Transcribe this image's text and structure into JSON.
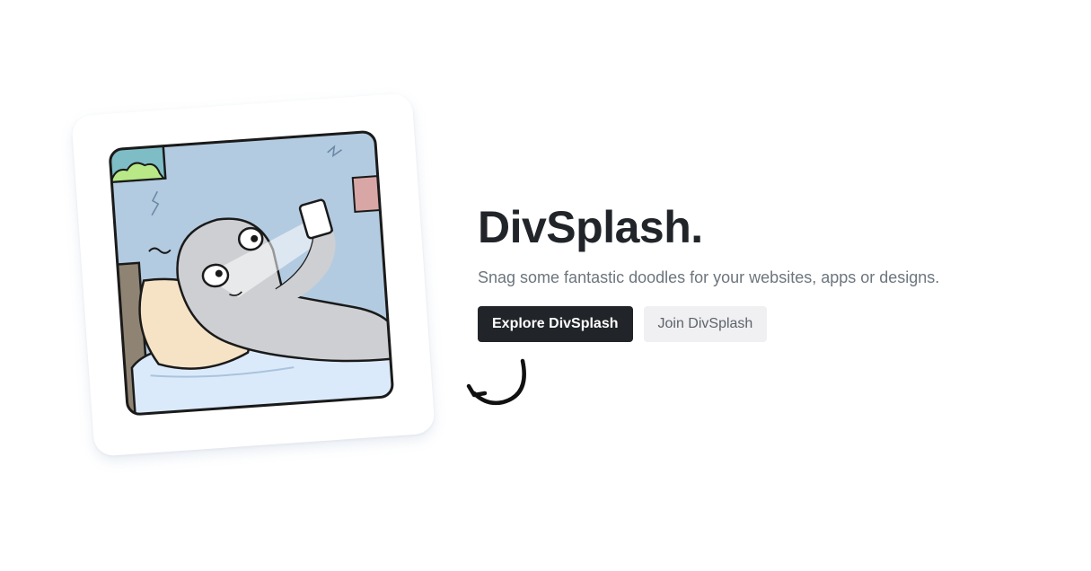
{
  "hero": {
    "title": "DivSplash.",
    "subtitle": "Snag some fantastic doodles for your websites, apps or designs."
  },
  "actions": {
    "explore_label": "Explore DivSplash",
    "join_label": "Join DivSplash"
  },
  "colors": {
    "primary": "#212529",
    "secondary_bg": "#f0f0f2",
    "subtitle_text": "#6c757d",
    "wall": "#b3cbe0"
  },
  "illustration": {
    "icon": "doodle-ghost-phone-in-bed-illustration"
  },
  "decoration": {
    "icon": "curved-arrow-icon"
  }
}
